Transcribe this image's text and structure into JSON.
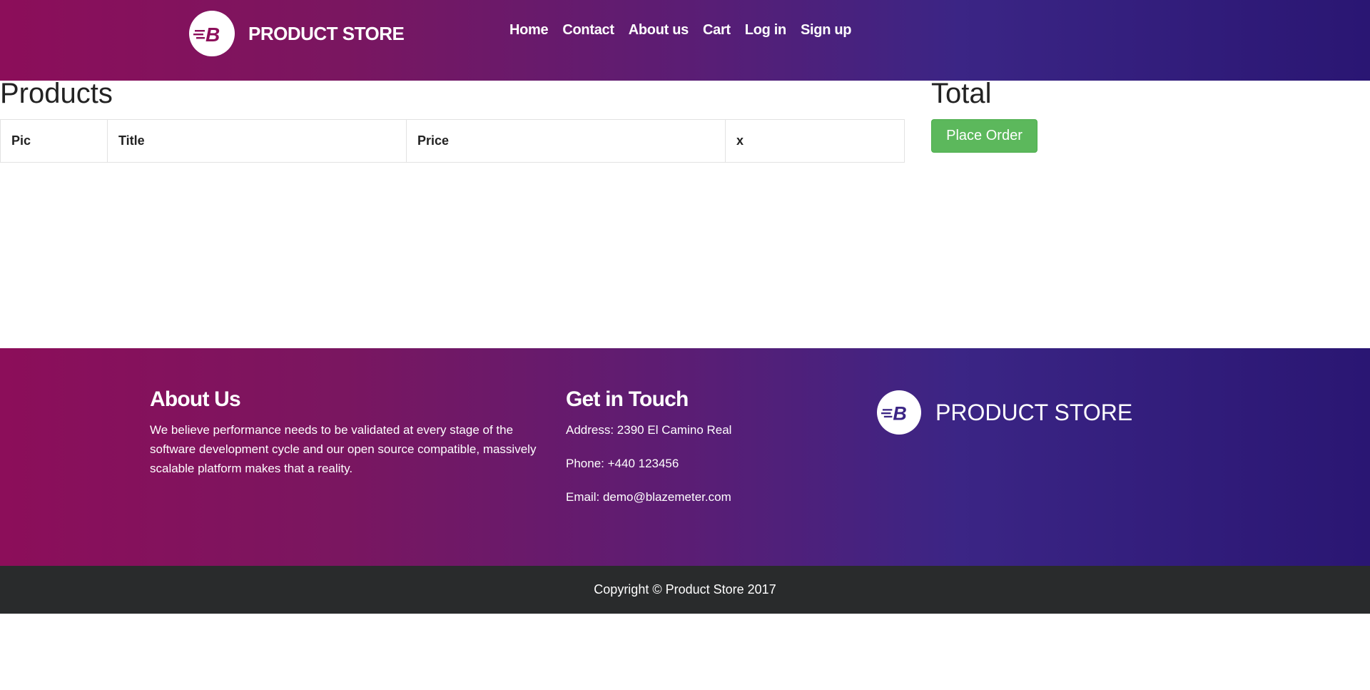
{
  "header": {
    "brand": "PRODUCT STORE",
    "logo_letter": "B",
    "nav": [
      "Home",
      "Contact",
      "About us",
      "Cart",
      "Log in",
      "Sign up"
    ]
  },
  "products": {
    "title": "Products",
    "columns": [
      "Pic",
      "Title",
      "Price",
      "x"
    ]
  },
  "total": {
    "title": "Total",
    "place_order_label": "Place Order"
  },
  "footer": {
    "about_title": "About Us",
    "about_text": "We believe performance needs to be validated at every stage of the software development cycle and our open source compatible, massively scalable platform makes that a reality.",
    "touch_title": "Get in Touch",
    "address": "Address: 2390 El Camino Real",
    "phone": "Phone: +440 123456",
    "email": "Email: demo@blazemeter.com",
    "brand": "PRODUCT STORE",
    "copyright": "Copyright © Product Store 2017"
  },
  "colors": {
    "gradient_start": "#8c0e5a",
    "gradient_end": "#2a1673",
    "place_order": "#5cb85c",
    "copyright_bg": "#292b2c"
  }
}
